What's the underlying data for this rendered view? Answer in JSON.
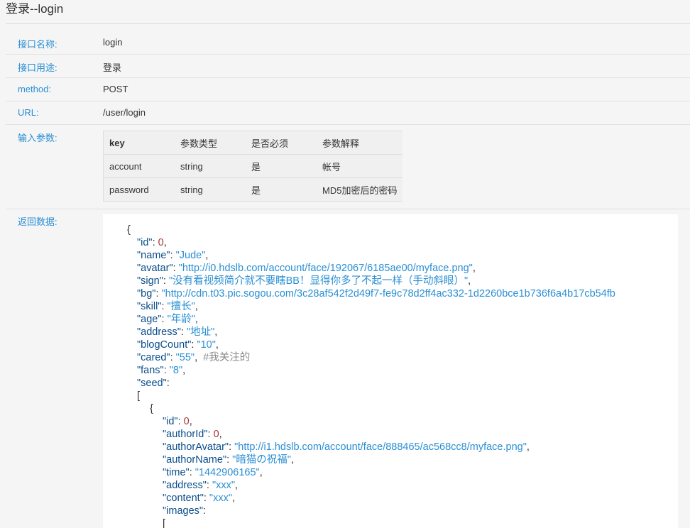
{
  "page": {
    "title": "登录--login"
  },
  "info": {
    "name_label": "接口名称:",
    "name_value": "login",
    "purpose_label": "接口用途:",
    "purpose_value": "登录",
    "method_label": "method:",
    "method_value": "POST",
    "url_label": "URL:",
    "url_value": "/user/login"
  },
  "params": {
    "label": "输入参数:",
    "headers": [
      "key",
      "参数类型",
      "是否必须",
      "参数解释"
    ],
    "rows": [
      [
        "account",
        "string",
        "是",
        "帐号"
      ],
      [
        "password",
        "string",
        "是",
        "MD5加密后的密码"
      ]
    ]
  },
  "response": {
    "label": "返回数据:",
    "open_brace": "{",
    "id_key": "\"id\"",
    "id_val": "0",
    "name_key": "\"name\"",
    "name_val": "\"Jude\"",
    "avatar_key": "\"avatar\"",
    "avatar_val": "\"http://i0.hdslb.com/account/face/192067/6185ae00/myface.png\"",
    "sign_key": "\"sign\"",
    "sign_val": "\"没有看视频简介就不要瞎BB！显得你多了不起一样（手动斜眼）\"",
    "bg_key": "\"bg\"",
    "bg_val": "\"http://cdn.t03.pic.sogou.com/3c28af542f2d49f7-fe9c78d2ff4ac332-1d2260bce1b736f6a4b17cb54fb",
    "skill_key": "\"skill\"",
    "skill_val": "\"擅长\"",
    "age_key": "\"age\"",
    "age_val": "\"年龄\"",
    "address_key": "\"address\"",
    "address_val": "\"地址\"",
    "blog_key": "\"blogCount\"",
    "blog_val": "\"10\"",
    "cared_key": "\"cared\"",
    "cared_val": "\"55\"",
    "cared_comment": "#我关注的",
    "fans_key": "\"fans\"",
    "fans_val": "\"8\"",
    "seed_key": "\"seed\"",
    "seed_open": "[",
    "item_open": "{",
    "sid_key": "\"id\"",
    "sid_val": "0",
    "author_id_key": "\"authorId\"",
    "author_id_val": "0",
    "author_avatar_key": "\"authorAvatar\"",
    "author_avatar_val": "\"http://i1.hdslb.com/account/face/888465/ac568cc8/myface.png\"",
    "author_name_key": "\"authorName\"",
    "author_name_val": "\"暗猫の祝福\"",
    "time_key": "\"time\"",
    "time_val": "\"1442906165\"",
    "s_address_key": "\"address\"",
    "s_address_val": "\"xxx\"",
    "content_key": "\"content\"",
    "content_val": "\"xxx\"",
    "images_key": "\"images\"",
    "images_open": "["
  }
}
